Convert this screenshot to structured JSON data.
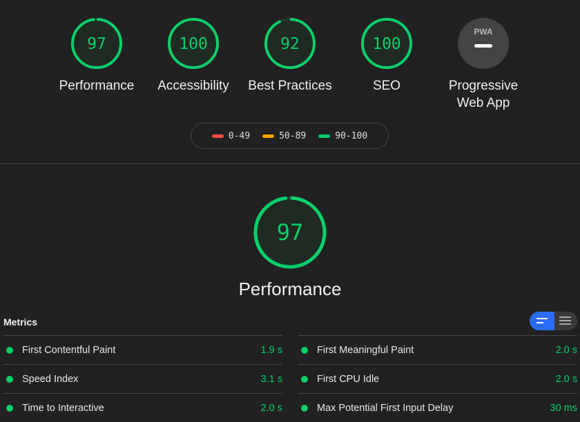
{
  "colors": {
    "pass": "#0cce6b",
    "average": "#ffa400",
    "fail": "#ff4e42",
    "pwa": "#9e9e9e"
  },
  "categories": [
    {
      "score": "97",
      "label": "Performance",
      "fill": 0.97
    },
    {
      "score": "100",
      "label": "Accessibility",
      "fill": 1.0
    },
    {
      "score": "92",
      "label": "Best Practices",
      "fill": 0.92
    },
    {
      "score": "100",
      "label": "SEO",
      "fill": 1.0
    },
    {
      "label_line1": "Progressive",
      "label_line2": "Web App",
      "badge": "PWA",
      "icon": "pwa-dash-icon"
    }
  ],
  "legend": [
    {
      "range": "0-49",
      "color": "#ff4e42"
    },
    {
      "range": "50-89",
      "color": "#ffa400"
    },
    {
      "range": "90-100",
      "color": "#0cce6b"
    }
  ],
  "performance": {
    "score": "97",
    "fill": 0.97,
    "title": "Performance"
  },
  "metrics": {
    "title": "Metrics",
    "view_toggle": {
      "left_icon": "summary-view-icon",
      "right_icon": "detailed-view-icon"
    },
    "left": [
      {
        "name": "First Contentful Paint",
        "value": "1.9 s"
      },
      {
        "name": "Speed Index",
        "value": "3.1 s"
      },
      {
        "name": "Time to Interactive",
        "value": "2.0 s"
      }
    ],
    "right": [
      {
        "name": "First Meaningful Paint",
        "value": "2.0 s"
      },
      {
        "name": "First CPU Idle",
        "value": "2.0 s"
      },
      {
        "name": "Max Potential First Input Delay",
        "value": "30 ms"
      }
    ]
  }
}
